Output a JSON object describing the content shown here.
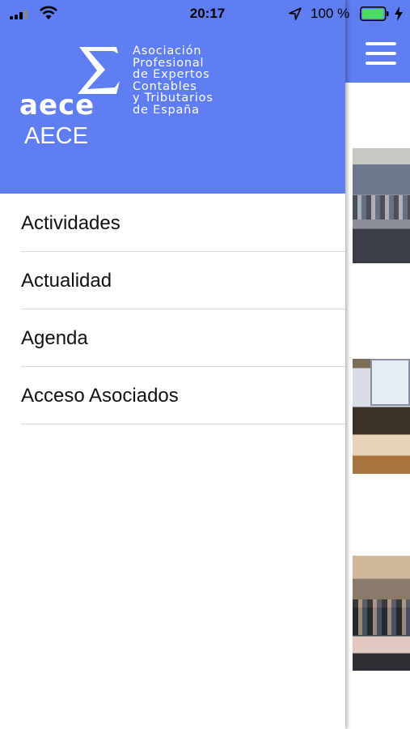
{
  "status_bar": {
    "time": "20:17",
    "battery": "100 %"
  },
  "drawer": {
    "logo_word": "aece",
    "logo_text": [
      "Asociación",
      "Profesional",
      "de Expertos",
      "Contables",
      "y Tributarios",
      "de España"
    ],
    "title": "AECE",
    "items": [
      {
        "label": "Actividades"
      },
      {
        "label": "Actualidad"
      },
      {
        "label": "Agenda"
      },
      {
        "label": "Acceso Asociados"
      }
    ]
  },
  "colors": {
    "accent": "#5e7ef2",
    "battery": "#4cd964"
  },
  "icons": {
    "menu": "hamburger-icon",
    "signal": "signal-icon",
    "wifi": "wifi-icon",
    "location": "location-arrow-icon",
    "battery": "battery-icon",
    "charging": "bolt-icon"
  }
}
